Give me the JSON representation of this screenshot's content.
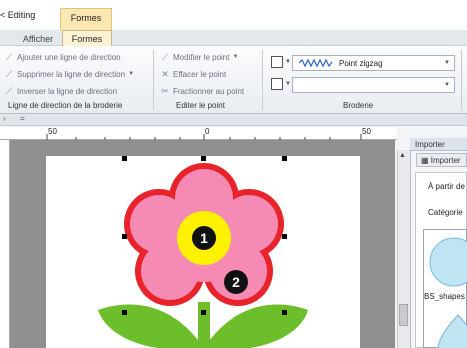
{
  "window": {
    "title_left": "< Editing",
    "context_tab": "Formes"
  },
  "tabs": [
    {
      "label": "Afficher"
    },
    {
      "label": "Formes"
    }
  ],
  "ribbon": {
    "group_direction": {
      "title": "Ligne de direction de la broderie",
      "items": [
        {
          "label": "Ajouter une ligne de direction",
          "icon": "add-direction-line-icon"
        },
        {
          "label": "Supprimer la ligne de direction",
          "icon": "delete-direction-line-icon"
        },
        {
          "label": "Inverser la ligne de direction",
          "icon": "invert-direction-line-icon"
        }
      ]
    },
    "group_point": {
      "title": "Editer le point",
      "items": [
        {
          "label": "Modifier le point",
          "icon": "modify-point-icon"
        },
        {
          "label": "Effacer le point",
          "icon": "erase-point-icon"
        },
        {
          "label": "Fractionner au point",
          "icon": "split-point-icon"
        }
      ]
    },
    "group_broderie": {
      "title": "Broderie",
      "stitch_value": "Point zigzag",
      "second_value": ""
    }
  },
  "ruler": {
    "labels": [
      "50",
      "0",
      "50"
    ]
  },
  "design": {
    "badges": [
      "1",
      "2"
    ],
    "colors": {
      "outline": "#e8232a",
      "petal": "#f58bb4",
      "center": "#fff200",
      "leaf": "#6cbe2b",
      "badge": "#111111"
    }
  },
  "panel": {
    "title": "Importer",
    "tab_label": "Importer",
    "source_label": "À partir de",
    "category_label": "Catégorie",
    "item_label": "BS_shapes"
  }
}
